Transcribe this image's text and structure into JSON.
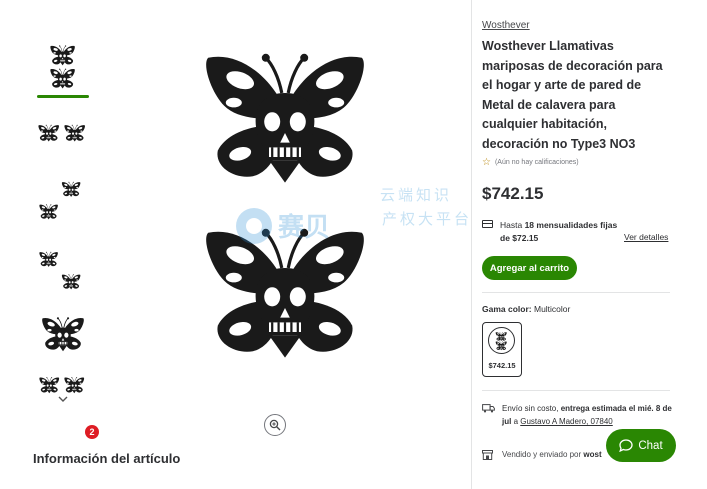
{
  "gallery": {
    "more_label": "˅",
    "notification_count": "2",
    "info_title": "Información del artículo"
  },
  "watermark": {
    "latin": "赛贝",
    "line1": "云端知识",
    "line2": "产权大平台"
  },
  "product": {
    "brand": "Wosthever",
    "title": "Wosthever Llamativas mariposas de decoración para el hogar y arte de pared de Metal de calavera para cualquier habitación, decoración no Type3 NO3",
    "rating_text": "(Aún no hay calificaciones)",
    "price": "$742.15",
    "installments_prefix": "Hasta ",
    "installments_bold": "18 mensualidades fijas",
    "installments_suffix": "de $72.15",
    "details_link": "Ver detalles",
    "add_to_cart": "Agregar al carrito",
    "color_label": "Gama color:",
    "color_value": "Multicolor",
    "swatch_price": "$742.15",
    "shipping_prefix": "Envío sin costo, ",
    "shipping_bold": "entrega estimada el mié. 8 de jul",
    "shipping_mid": " a ",
    "shipping_address": "Gustavo A Madero, 07840",
    "sold_prefix": "Vendido y enviado por ",
    "sold_by": "wost"
  },
  "chat": {
    "label": "Chat"
  },
  "colors": {
    "accent": "#2a8703",
    "badge": "#de1c24",
    "text": "#2e2f32"
  }
}
